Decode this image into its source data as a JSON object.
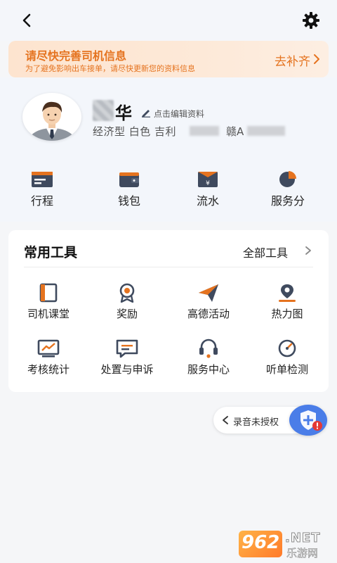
{
  "banner": {
    "title": "请尽快完善司机信息",
    "subtitle": "为了避免影响出车接单，请尽快更新您的资料信息",
    "action": "去补齐"
  },
  "profile": {
    "name": "华",
    "edit_label": "点击编辑资料",
    "car_info": "经济型 白色 吉利",
    "plate_prefix": "赣A"
  },
  "quick_actions": [
    {
      "label": "行程",
      "icon": "itinerary-icon"
    },
    {
      "label": "钱包",
      "icon": "wallet-icon"
    },
    {
      "label": "流水",
      "icon": "income-flow-icon"
    },
    {
      "label": "服务分",
      "icon": "service-score-icon"
    }
  ],
  "tools": {
    "title": "常用工具",
    "all_label": "全部工具",
    "items": [
      {
        "label": "司机课堂",
        "icon": "driver-class-icon"
      },
      {
        "label": "奖励",
        "icon": "reward-icon"
      },
      {
        "label": "高德活动",
        "icon": "amap-activity-icon"
      },
      {
        "label": "热力图",
        "icon": "heatmap-icon"
      },
      {
        "label": "考核统计",
        "icon": "assessment-stats-icon"
      },
      {
        "label": "处置与申诉",
        "icon": "appeal-icon"
      },
      {
        "label": "服务中心",
        "icon": "service-center-icon"
      },
      {
        "label": "听单检测",
        "icon": "order-check-icon"
      }
    ]
  },
  "recording": {
    "label": "录音未授权"
  },
  "watermark": {
    "number": "962",
    "net": ".NET",
    "cn": "乐游网"
  },
  "colors": {
    "accent": "#e5731f",
    "icon_dark": "#3f4a5e",
    "primary_blue": "#4a7de8",
    "alert_red": "#e53935"
  }
}
